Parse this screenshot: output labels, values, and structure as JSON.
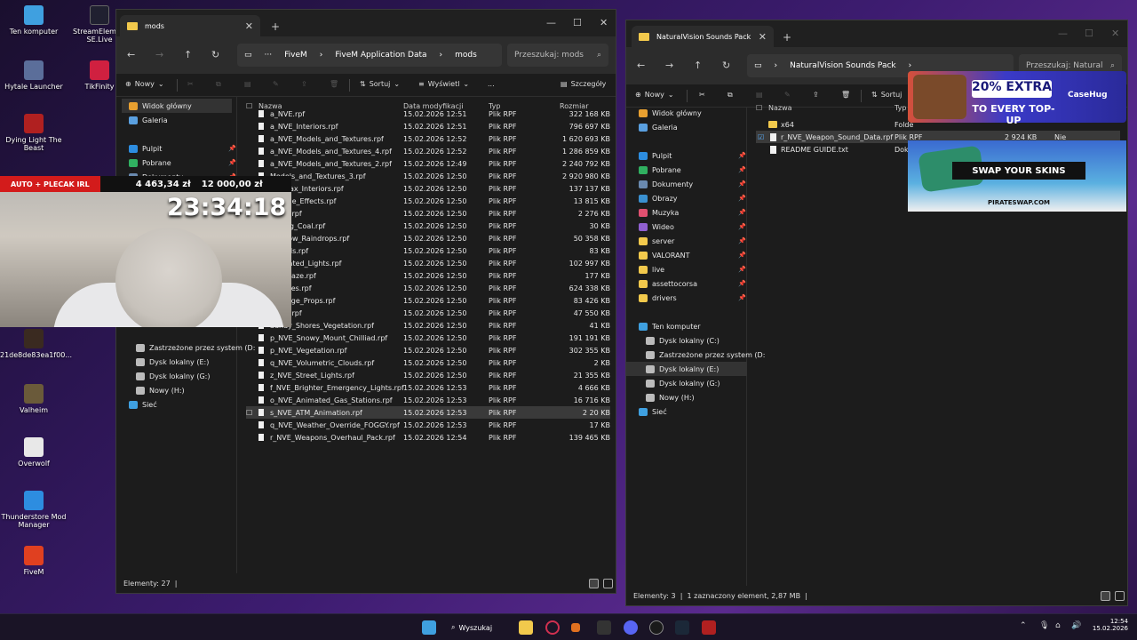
{
  "desktop": {
    "icons": [
      "Ten komputer",
      "StreamElements SE.Live",
      "Hytale Launcher",
      "TikFinity",
      "Dying Light The Beast",
      "21de8de83ea1f00...",
      "Valheim",
      "Overwolf",
      "Thunderstore Mod Manager",
      "FiveM"
    ]
  },
  "win1": {
    "tab": "mods",
    "breadcrumb": [
      "FiveM",
      "FiveM Application Data",
      "mods"
    ],
    "search": "Przeszukaj: mods",
    "cmd": {
      "new": "Nowy",
      "sort": "Sortuj",
      "view": "Wyświetl",
      "details": "Szczegóły",
      "more": "..."
    },
    "sidebar": [
      "Widok główny",
      "Galeria",
      "Pulpit",
      "Pobrane",
      "Dokumenty",
      "Dysk lokalny (E:)",
      "Zastrzeżone przez system (D:",
      "Dysk lokalny (E:)",
      "Dysk lokalny (G:)",
      "Nowy (H:)",
      "Sieć"
    ],
    "columns": {
      "name": "Nazwa",
      "date": "Data modyfikacji",
      "type": "Typ",
      "size": "Rozmiar"
    },
    "files": [
      {
        "name": "a_NVE.rpf",
        "date": "15.02.2026 12:51",
        "type": "Plik RPF",
        "size": "322 168 KB"
      },
      {
        "name": "a_NVE_Interiors.rpf",
        "date": "15.02.2026 12:51",
        "type": "Plik RPF",
        "size": "796 697 KB"
      },
      {
        "name": "a_NVE_Models_and_Textures.rpf",
        "date": "15.02.2026 12:52",
        "type": "Plik RPF",
        "size": "1 620 693 KB"
      },
      {
        "name": "a_NVE_Models_and_Textures_4.rpf",
        "date": "15.02.2026 12:52",
        "type": "Plik RPF",
        "size": "1 286 859 KB"
      },
      {
        "name": "a_NVE_Models_and_Textures_2.rpf",
        "date": "15.02.2026 12:49",
        "type": "Plik RPF",
        "size": "2 240 792 KB"
      },
      {
        "name": "Models_and_Textures_3.rpf",
        "date": "15.02.2026 12:50",
        "type": "Plik RPF",
        "size": "2 920 980 KB"
      },
      {
        "name": "Parallax_Interiors.rpf",
        "date": "15.02.2026 12:50",
        "type": "Plik RPF",
        "size": "137 137 KB"
      },
      {
        "name": "Particle_Effects.rpf",
        "date": "15.02.2026 12:50",
        "type": "Plik RPF",
        "size": "13 815 KB"
      },
      {
        "name": "Props.rpf",
        "date": "15.02.2026 12:50",
        "type": "Plik RPF",
        "size": "2 276 KB"
      },
      {
        "name": "Rolling_Coal.rpf",
        "date": "15.02.2026 12:50",
        "type": "Plik RPF",
        "size": "30 KB"
      },
      {
        "name": "Window_Raindrops.rpf",
        "date": "15.02.2026 12:50",
        "type": "Plik RPF",
        "size": "50 358 KB"
      },
      {
        "name": "Carcols.rpf",
        "date": "15.02.2026 12:50",
        "type": "Plik RPF",
        "size": "83 KB"
      },
      {
        "name": "Animated_Lights.rpf",
        "date": "15.02.2026 12:50",
        "type": "Plik RPF",
        "size": "102 997 KB"
      },
      {
        "name": "Heathaze.rpf",
        "date": "15.02.2026 12:50",
        "type": "Plik RPF",
        "size": "177 KB"
      },
      {
        "name": "Vehicles.rpf",
        "date": "15.02.2026 12:50",
        "type": "Plik RPF",
        "size": "624 338 KB"
      },
      {
        "name": "Damage_Props.rpf",
        "date": "15.02.2026 12:50",
        "type": "Plik RPF",
        "size": "83 426 KB"
      },
      {
        "name": "Props.rpf",
        "date": "15.02.2026 12:50",
        "type": "Plik RPF",
        "size": "47 550 KB"
      },
      {
        "name": "Sandy_Shores_Vegetation.rpf",
        "date": "15.02.2026 12:50",
        "type": "Plik RPF",
        "size": "41 KB"
      },
      {
        "name": "p_NVE_Snowy_Mount_Chilliad.rpf",
        "date": "15.02.2026 12:50",
        "type": "Plik RPF",
        "size": "191 191 KB"
      },
      {
        "name": "p_NVE_Vegetation.rpf",
        "date": "15.02.2026 12:50",
        "type": "Plik RPF",
        "size": "302 355 KB"
      },
      {
        "name": "q_NVE_Volumetric_Clouds.rpf",
        "date": "15.02.2026 12:50",
        "type": "Plik RPF",
        "size": "2 KB"
      },
      {
        "name": "z_NVE_Street_Lights.rpf",
        "date": "15.02.2026 12:50",
        "type": "Plik RPF",
        "size": "21 355 KB"
      },
      {
        "name": "f_NVE_Brighter_Emergency_Lights.rpf",
        "date": "15.02.2026 12:53",
        "type": "Plik RPF",
        "size": "4 666 KB"
      },
      {
        "name": "o_NVE_Animated_Gas_Stations.rpf",
        "date": "15.02.2026 12:53",
        "type": "Plik RPF",
        "size": "16 716 KB"
      },
      {
        "name": "s_NVE_ATM_Animation.rpf",
        "date": "15.02.2026 12:53",
        "type": "Plik RPF",
        "size": "2 20 KB"
      },
      {
        "name": "q_NVE_Weather_Override_FOGGY.rpf",
        "date": "15.02.2026 12:53",
        "type": "Plik RPF",
        "size": "17 KB"
      },
      {
        "name": "r_NVE_Weapons_Overhaul_Pack.rpf",
        "date": "15.02.2026 12:54",
        "type": "Plik RPF",
        "size": "139 465 KB"
      }
    ],
    "status": "Elementy: 27"
  },
  "win2": {
    "tab": "NaturalVision Sounds Pack",
    "breadcrumb": "NaturalVision Sounds Pack",
    "search": "Przeszukaj: Natural",
    "cmd": {
      "new": "Nowy",
      "sort": "Sortuj"
    },
    "sidebar": [
      "Widok główny",
      "Galeria",
      "Pulpit",
      "Pobrane",
      "Dokumenty",
      "Obrazy",
      "Muzyka",
      "Wideo",
      "server",
      "VALORANT",
      "live",
      "assettocorsa",
      "drivers",
      "Ten komputer",
      "Dysk lokalny (C:)",
      "Zastrzeżone przez system (D:",
      "Dysk lokalny (E:)",
      "Dysk lokalny (G:)",
      "Nowy (H:)",
      "Sieć"
    ],
    "columns": {
      "name": "Nazwa",
      "type": "Typ"
    },
    "files": [
      {
        "name": "x64",
        "type": "Folde"
      },
      {
        "name": "r_NVE_Weapon_Sound_Data.rpf",
        "type": "Plik RPF",
        "size": "2 924 KB",
        "extra": "Nie"
      },
      {
        "name": "README GUIDE.txt",
        "type": "Dok"
      }
    ],
    "status": "Elementy: 3",
    "status2": "1 zaznaczony element, 2,87 MB"
  },
  "webcam": {
    "banner": "AUTO + PLECAK IRL",
    "amount": "4 463,34 zł",
    "goal": "12 000,00 zł",
    "timer": "23:34:18"
  },
  "ads": {
    "top": "20% EXTRA",
    "top2": "TO EVERY TOP-UP",
    "brand": "CaseHug",
    "mid": "SWAP YOUR SKINS",
    "site": "PIRATESWAP.COM"
  },
  "taskbar": {
    "search": "Wyszukaj",
    "time": "12:54",
    "date": "15.02.2026"
  }
}
